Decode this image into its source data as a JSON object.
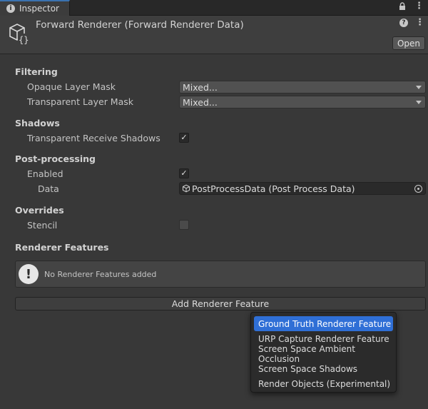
{
  "tab": {
    "title": "Inspector"
  },
  "header": {
    "title": "Forward Renderer (Forward Renderer Data)",
    "open_label": "Open"
  },
  "sections": {
    "filtering": {
      "title": "Filtering",
      "opaque_label": "Opaque Layer Mask",
      "opaque_value": "Mixed...",
      "transparent_label": "Transparent Layer Mask",
      "transparent_value": "Mixed..."
    },
    "shadows": {
      "title": "Shadows",
      "receive_label": "Transparent Receive Shadows",
      "receive_checked": true
    },
    "post_processing": {
      "title": "Post-processing",
      "enabled_label": "Enabled",
      "enabled_checked": true,
      "data_label": "Data",
      "data_value": "PostProcessData (Post Process Data)"
    },
    "overrides": {
      "title": "Overrides",
      "stencil_label": "Stencil",
      "stencil_checked": false
    },
    "renderer_features": {
      "title": "Renderer Features",
      "empty_message": "No Renderer Features added",
      "add_button": "Add Renderer Feature"
    }
  },
  "menu": {
    "items": [
      "Ground Truth Renderer Feature",
      "URP Capture Renderer Feature",
      "Screen Space Ambient Occlusion",
      "Screen Space Shadows",
      "Render Objects (Experimental)"
    ],
    "selected_index": 0
  },
  "colors": {
    "accent": "#2f6fd6",
    "background": "#383838"
  }
}
